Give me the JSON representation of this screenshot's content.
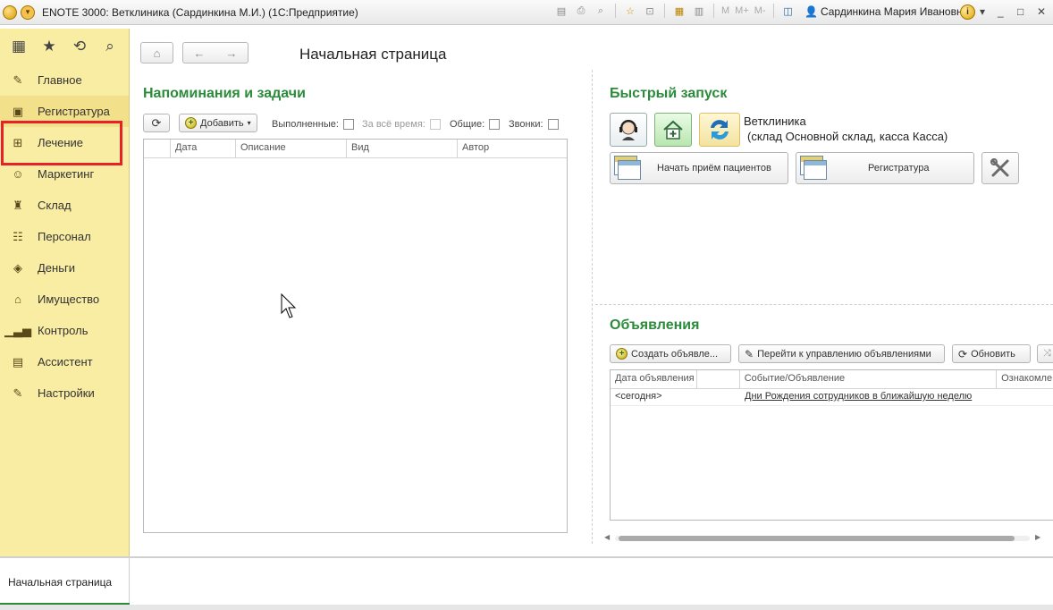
{
  "window": {
    "title": "ENOTE 3000: Ветклиника (Сардинкина М.И.)  (1С:Предприятие)",
    "user": "Сардинкина Мария Ивановна",
    "memory_buttons": [
      "M",
      "M+",
      "M-"
    ],
    "controls": [
      "_",
      "□",
      "✕"
    ]
  },
  "sidebar": {
    "items": [
      {
        "label": "Главное",
        "icon": "paperclip-icon"
      },
      {
        "label": "Регистратура",
        "icon": "registry-icon"
      },
      {
        "label": "Лечение",
        "icon": "medical-kit-icon"
      },
      {
        "label": "Маркетинг",
        "icon": "marketing-icon"
      },
      {
        "label": "Склад",
        "icon": "warehouse-icon"
      },
      {
        "label": "Персонал",
        "icon": "staff-icon"
      },
      {
        "label": "Деньги",
        "icon": "money-icon"
      },
      {
        "label": "Имущество",
        "icon": "property-icon"
      },
      {
        "label": "Контроль",
        "icon": "chart-icon"
      },
      {
        "label": "Ассистент",
        "icon": "assistant-icon"
      },
      {
        "label": "Настройки",
        "icon": "wrench-icon"
      }
    ],
    "highlight_color": "#e8202a"
  },
  "page": {
    "title": "Начальная страница"
  },
  "reminders": {
    "title": "Напоминания и задачи",
    "add_label": "Добавить",
    "filters": {
      "done": "Выполненные:",
      "all_time": "За всё время:",
      "common": "Общие:",
      "calls": "Звонки:"
    },
    "columns": [
      "Дата",
      "Описание",
      "Вид",
      "Автор"
    ]
  },
  "quicklaunch": {
    "title": "Быстрый запуск",
    "clinic_name": "Ветклиника",
    "clinic_details": "(склад Основной склад, касса Касса)",
    "btn_start_reception": "Начать приём пациентов",
    "btn_registry": "Регистратура"
  },
  "announcements": {
    "title": "Объявления",
    "btn_create": "Создать объявле...",
    "btn_manage": "Перейти к управлению объявлениями",
    "btn_refresh": "Обновить",
    "columns": [
      "Дата объявления",
      "",
      "Событие/Объявление",
      "Ознакомле"
    ],
    "rows": [
      {
        "date": "<сегодня>",
        "event": "Дни Рождения сотрудников в ближайшую неделю"
      }
    ]
  },
  "bottom_tabs": {
    "home": "Начальная страница"
  },
  "colors": {
    "accent_green": "#2b8b3a",
    "sidebar_bg": "#f9eda4"
  }
}
